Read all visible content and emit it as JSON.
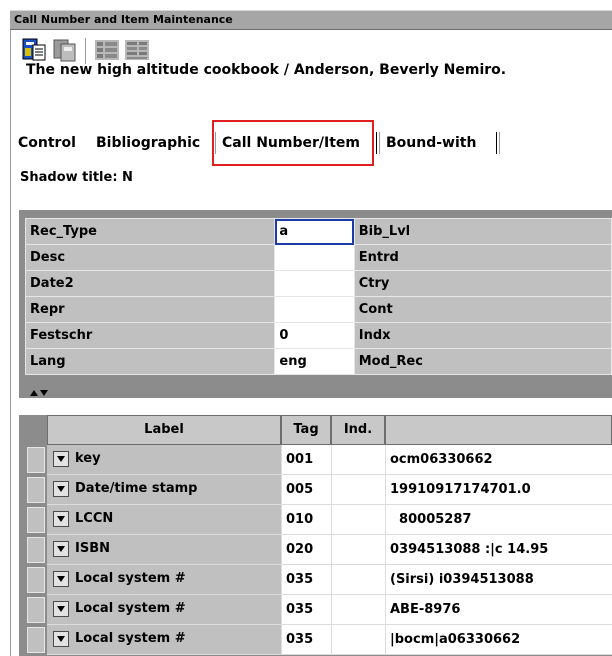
{
  "window": {
    "title": "Call Number and Item Maintenance"
  },
  "toolbar": {
    "icons": [
      "catalog-record-icon",
      "item-copy-icon",
      "list-view-icon",
      "grid-view-icon"
    ]
  },
  "record": {
    "title": "The new high altitude cookbook / Anderson, Beverly Nemiro."
  },
  "tabs": [
    {
      "label": "Control"
    },
    {
      "label": "Bibliographic"
    },
    {
      "label": "Call Number/Item"
    },
    {
      "label": "Bound-with"
    }
  ],
  "shadow_title": "Shadow title: N",
  "fixed_fields": [
    {
      "label": "Rec_Type",
      "value": "a",
      "label2": "Bib_Lvl"
    },
    {
      "label": "Desc",
      "value": "",
      "label2": "Entrd"
    },
    {
      "label": "Date2",
      "value": "",
      "label2": "Ctry"
    },
    {
      "label": "Repr",
      "value": "",
      "label2": "Cont"
    },
    {
      "label": "Festschr",
      "value": "0",
      "label2": "Indx"
    },
    {
      "label": "Lang",
      "value": "eng",
      "label2": "Mod_Rec"
    }
  ],
  "grid": {
    "headers": {
      "label": "Label",
      "tag": "Tag",
      "ind": "Ind."
    },
    "rows": [
      {
        "label": "key",
        "tag": "001",
        "ind": "",
        "value": "ocm06330662"
      },
      {
        "label": "Date/time stamp",
        "tag": "005",
        "ind": "",
        "value": "19910917174701.0"
      },
      {
        "label": "LCCN",
        "tag": "010",
        "ind": "",
        "value": "  80005287"
      },
      {
        "label": "ISBN",
        "tag": "020",
        "ind": "",
        "value": "0394513088 :|c 14.95"
      },
      {
        "label": "Local system #",
        "tag": "035",
        "ind": "",
        "value": "(Sirsi) i0394513088"
      },
      {
        "label": "Local system #",
        "tag": "035",
        "ind": "",
        "value": "ABE-8976"
      },
      {
        "label": "Local system #",
        "tag": "035",
        "ind": "",
        "value": "|bocm|a06330662"
      }
    ]
  },
  "colors": {
    "highlight": "#e02020",
    "selection": "#1e3aa8",
    "panel": "#c0c0c0"
  }
}
